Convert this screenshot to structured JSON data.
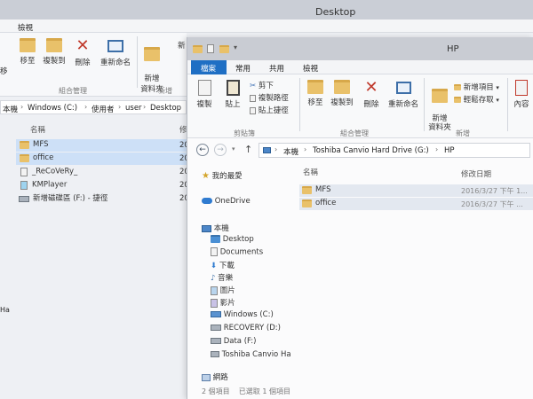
{
  "back_window": {
    "title": "Desktop",
    "tab_view": "檢視",
    "ribbon": {
      "move_to": "移至",
      "copy_to": "複製到",
      "delete": "刪除",
      "rename": "重新命名",
      "new_folder": "新增\n資料夾",
      "new_partial": "新",
      "group_organize": "組合管理",
      "group_new": "新增"
    },
    "breadcrumb": {
      "this_pc": "本機",
      "drive": "Windows (C:)",
      "users": "使用者",
      "user": "user",
      "desktop": "Desktop"
    },
    "column_name": "名稱",
    "column_date_partial": "修",
    "files": [
      {
        "name": "MFS",
        "date_partial": "20"
      },
      {
        "name": "office",
        "date_partial": "20"
      },
      {
        "name": "_ReCoVeRy_",
        "date_partial": "20"
      },
      {
        "name": "KMPlayer",
        "date_partial": "20"
      },
      {
        "name": "新增磁碟區 (F:) - 捷徑",
        "date_partial": "20"
      }
    ],
    "left_partial_labels": [
      "移",
      "Ha"
    ]
  },
  "front_window": {
    "title": "HP",
    "tabs": [
      "檔案",
      "常用",
      "共用",
      "檢視"
    ],
    "quick_access_arrow": "▾",
    "ribbon": {
      "copy": "複製",
      "paste": "貼上",
      "cut": "剪下",
      "copy_path": "複製路徑",
      "paste_shortcut": "貼上捷徑",
      "move_to": "移至",
      "copy_to": "複製到",
      "delete": "刪除",
      "rename": "重新命名",
      "new_folder": "新增\n資料夾",
      "new_item": "新增項目",
      "easy_access": "輕鬆存取",
      "properties_partial": "內容",
      "group_clipboard": "剪貼簿",
      "group_organize": "組合管理",
      "group_new": "新增"
    },
    "address": {
      "this_pc": "本機",
      "drive": "Toshiba Canvio Hard Drive (G:)",
      "folder": "HP"
    },
    "nav": {
      "favorites": "我的最愛",
      "onedrive": "OneDrive",
      "this_pc": "本機",
      "desktop": "Desktop",
      "documents": "Documents",
      "downloads": "下載",
      "music": "音樂",
      "pictures": "圖片",
      "videos": "影片",
      "windows_c": "Windows (C:)",
      "recovery_d": "RECOVERY (D:)",
      "data_f": "Data (F:)",
      "toshiba": "Toshiba Canvio Ha",
      "network": "網路"
    },
    "columns": {
      "name": "名稱",
      "date": "修改日期"
    },
    "files": [
      {
        "name": "MFS",
        "date": "2016/3/27 下午 1..."
      },
      {
        "name": "office",
        "date": "2016/3/27 下午 ..."
      }
    ],
    "status": "2 個項目    已選取 1 個項目"
  },
  "colors": {
    "file_tab": "#1f6fc4",
    "selection": "#cde0f7",
    "title_bar": "#c9ccd3"
  }
}
